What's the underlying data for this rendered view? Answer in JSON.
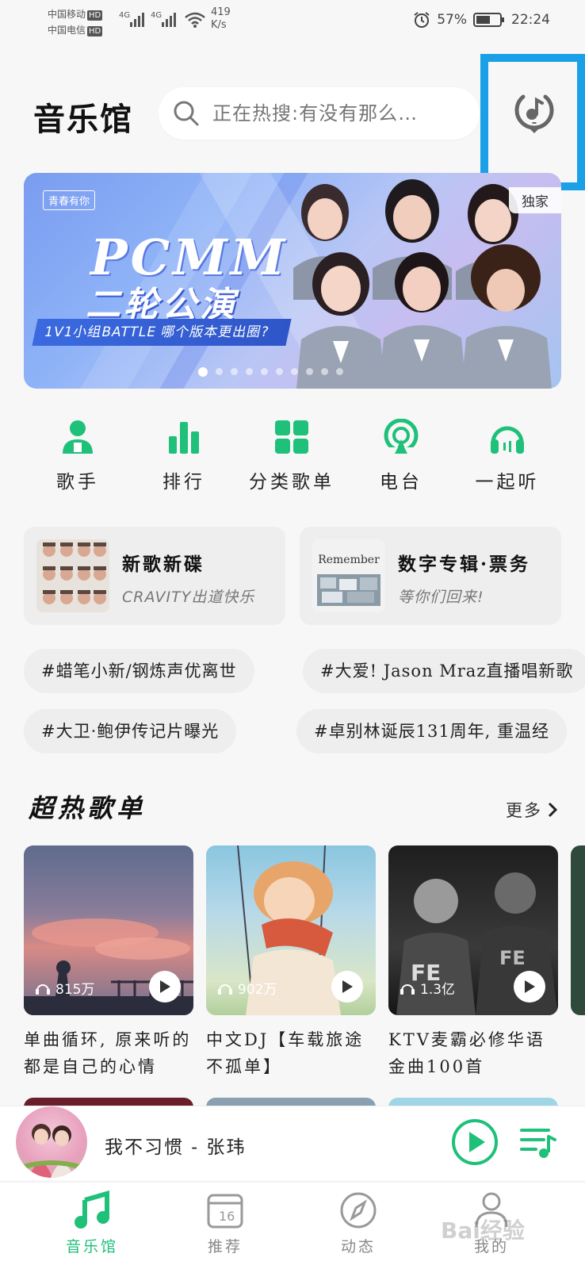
{
  "status_bar": {
    "carrier1": "中国移动",
    "carrier2": "中国电信",
    "hd": "HD",
    "net_label": "4G",
    "net_speed_value": "419",
    "net_speed_unit": "K/s",
    "battery": "57%",
    "time": "22:24"
  },
  "header": {
    "title": "音乐馆",
    "search_placeholder": "正在热搜:有没有那么…"
  },
  "banner": {
    "logo": "青春有你",
    "headline": "PCMM",
    "headline2": "二轮公演",
    "subline": "1V1小组BATTLE  哪个版本更出圈?",
    "tag": "独家",
    "dot_count": 10,
    "active_dot": 0
  },
  "categories": [
    {
      "label": "歌手",
      "icon": "singer-icon"
    },
    {
      "label": "排行",
      "icon": "chart-bars-icon"
    },
    {
      "label": "分类歌单",
      "icon": "grid-icon"
    },
    {
      "label": "电台",
      "icon": "radio-icon"
    },
    {
      "label": "一起听",
      "icon": "headphones-icon"
    }
  ],
  "feature_cards": [
    {
      "title": "新歌新碟",
      "subtitle": "CRAVITY出道快乐"
    },
    {
      "title": "数字专辑·票务",
      "subtitle": "等你们回来!",
      "thumb_text": "Remember"
    }
  ],
  "hot_tags": [
    "#蜡笔小新/钢炼声优离世",
    "#大爱! Jason Mraz直播唱新歌",
    "#大卫·鲍伊传记片曝光",
    "#卓别林诞辰131周年, 重温经"
  ],
  "section": {
    "title": "超热歌单",
    "more": "更多"
  },
  "playlists": [
    {
      "plays": "815万",
      "title": "单曲循环, 原来听的都是自己的心情"
    },
    {
      "plays": "902万",
      "title": "中文DJ【车载旅途不孤单】"
    },
    {
      "plays": "1.3亿",
      "title": "KTV麦霸必修华语金曲100首"
    }
  ],
  "mini_player": {
    "track": "我不习惯 - 张玮"
  },
  "tabs": [
    {
      "label": "音乐馆",
      "icon": "music-note-icon",
      "active": true
    },
    {
      "label": "推荐",
      "icon": "calendar-icon",
      "active": false,
      "calendar_day": "16"
    },
    {
      "label": "动态",
      "icon": "compass-icon",
      "active": false
    },
    {
      "label": "我的",
      "icon": "profile-icon",
      "active": false
    }
  ],
  "watermark": "Bai经验",
  "colors": {
    "accent": "#1ec07a",
    "highlight_box": "#1aa0e6"
  }
}
